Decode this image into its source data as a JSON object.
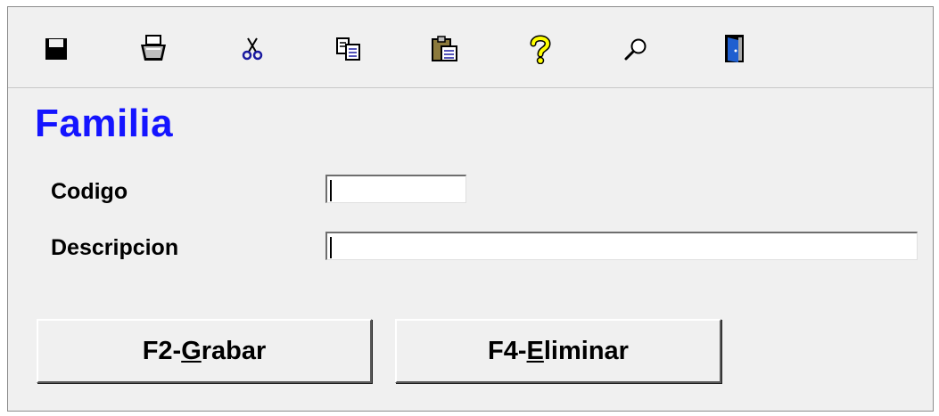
{
  "toolbar": {
    "items": [
      {
        "name": "save-icon"
      },
      {
        "name": "print-icon"
      },
      {
        "name": "cut-icon"
      },
      {
        "name": "copy-icon"
      },
      {
        "name": "paste-icon"
      },
      {
        "name": "help-icon"
      },
      {
        "name": "search-icon"
      },
      {
        "name": "exit-door-icon"
      }
    ]
  },
  "form": {
    "title": "Familia",
    "codigo_label": "Codigo",
    "codigo_value": "",
    "descripcion_label": "Descripcion",
    "descripcion_value": ""
  },
  "buttons": {
    "grabar_prefix": "F2-",
    "grabar_mnemonic": "G",
    "grabar_rest": "rabar",
    "eliminar_prefix": "F4-",
    "eliminar_mnemonic": "E",
    "eliminar_rest": "liminar"
  },
  "colors": {
    "title": "#1414ff",
    "window_bg": "#f0f0f0"
  }
}
